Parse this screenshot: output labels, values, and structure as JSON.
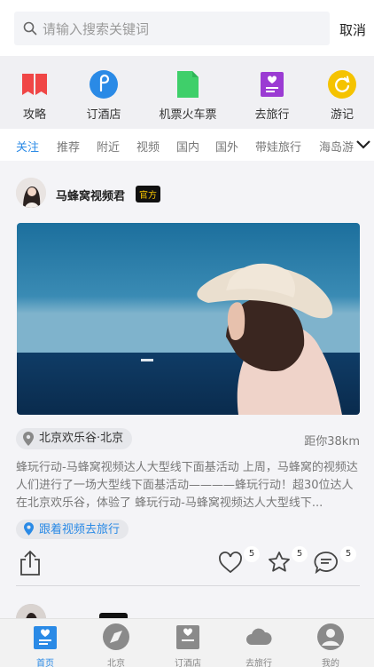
{
  "search": {
    "placeholder": "请输入搜索关键词",
    "cancel": "取消"
  },
  "quick_nav": [
    {
      "label": "攻略",
      "icon": "bookmark-icon",
      "color": "#f04646"
    },
    {
      "label": "订酒店",
      "icon": "hotel-icon",
      "color": "#2a8ae6"
    },
    {
      "label": "机票火车票",
      "icon": "ticket-icon",
      "color": "#3fcf6a"
    },
    {
      "label": "去旅行",
      "icon": "travel-icon",
      "color": "#9b3bd3"
    },
    {
      "label": "游记",
      "icon": "travelogue-icon",
      "color": "#f5c300"
    }
  ],
  "tabs": [
    "关注",
    "推荐",
    "附近",
    "视频",
    "国内",
    "国外",
    "带娃旅行",
    "海岛游"
  ],
  "active_tab": "关注",
  "post": {
    "author": "马蜂窝视频君",
    "badge": "官方",
    "location": "北京欢乐谷·北京",
    "distance": "距你38km",
    "description": "蜂玩行动-马蜂窝视频达人大型线下面基活动 上周，马蜂窝的视频达人们进行了一场大型线下面基活动————蜂玩行动！超30位达人在北京欢乐谷，体验了 蜂玩行动-马蜂窝视频达人大型线下...",
    "follow_label": "跟着视频去旅行",
    "likes": "5",
    "favorites": "5",
    "comments": "5"
  },
  "tabbar": [
    {
      "label": "首页",
      "icon": "home-icon"
    },
    {
      "label": "北京",
      "icon": "compass-icon"
    },
    {
      "label": "订酒店",
      "icon": "hotel-icon"
    },
    {
      "label": "去旅行",
      "icon": "cloud-icon"
    },
    {
      "label": "我的",
      "icon": "profile-icon"
    }
  ],
  "colors": {
    "accent": "#2a8ae6",
    "badge_text": "#f5c300"
  }
}
